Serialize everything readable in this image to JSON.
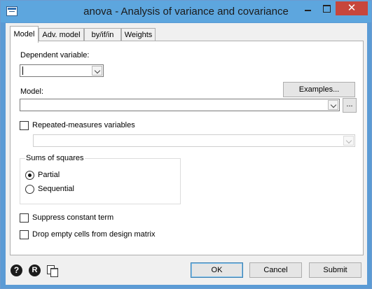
{
  "window": {
    "title": "anova - Analysis of variance and covariance",
    "close_glyph": "✕"
  },
  "tabs": [
    {
      "label": "Model",
      "active": true
    },
    {
      "label": "Adv. model",
      "active": false
    },
    {
      "label": "by/if/in",
      "active": false
    },
    {
      "label": "Weights",
      "active": false
    }
  ],
  "model_tab": {
    "dependent_variable_label": "Dependent variable:",
    "dependent_variable_value": "",
    "model_label": "Model:",
    "model_value": "",
    "examples_button": "Examples...",
    "browse_button": "...",
    "repeated_measures": {
      "label": "Repeated-measures variables",
      "checked": false,
      "value": ""
    },
    "sums_of_squares": {
      "title": "Sums of squares",
      "options": [
        {
          "label": "Partial",
          "selected": true
        },
        {
          "label": "Sequential",
          "selected": false
        }
      ]
    },
    "suppress_constant": {
      "label": "Suppress constant term",
      "checked": false
    },
    "drop_empty_cells": {
      "label": "Drop empty cells from design matrix",
      "checked": false
    }
  },
  "footer": {
    "help_icon_glyph": "?",
    "reset_icon_glyph": "R",
    "ok_button": "OK",
    "cancel_button": "Cancel",
    "submit_button": "Submit"
  },
  "colors": {
    "titlebar": "#5da6de",
    "close_button": "#c7463c",
    "dialog_background": "#f0f0f0"
  }
}
